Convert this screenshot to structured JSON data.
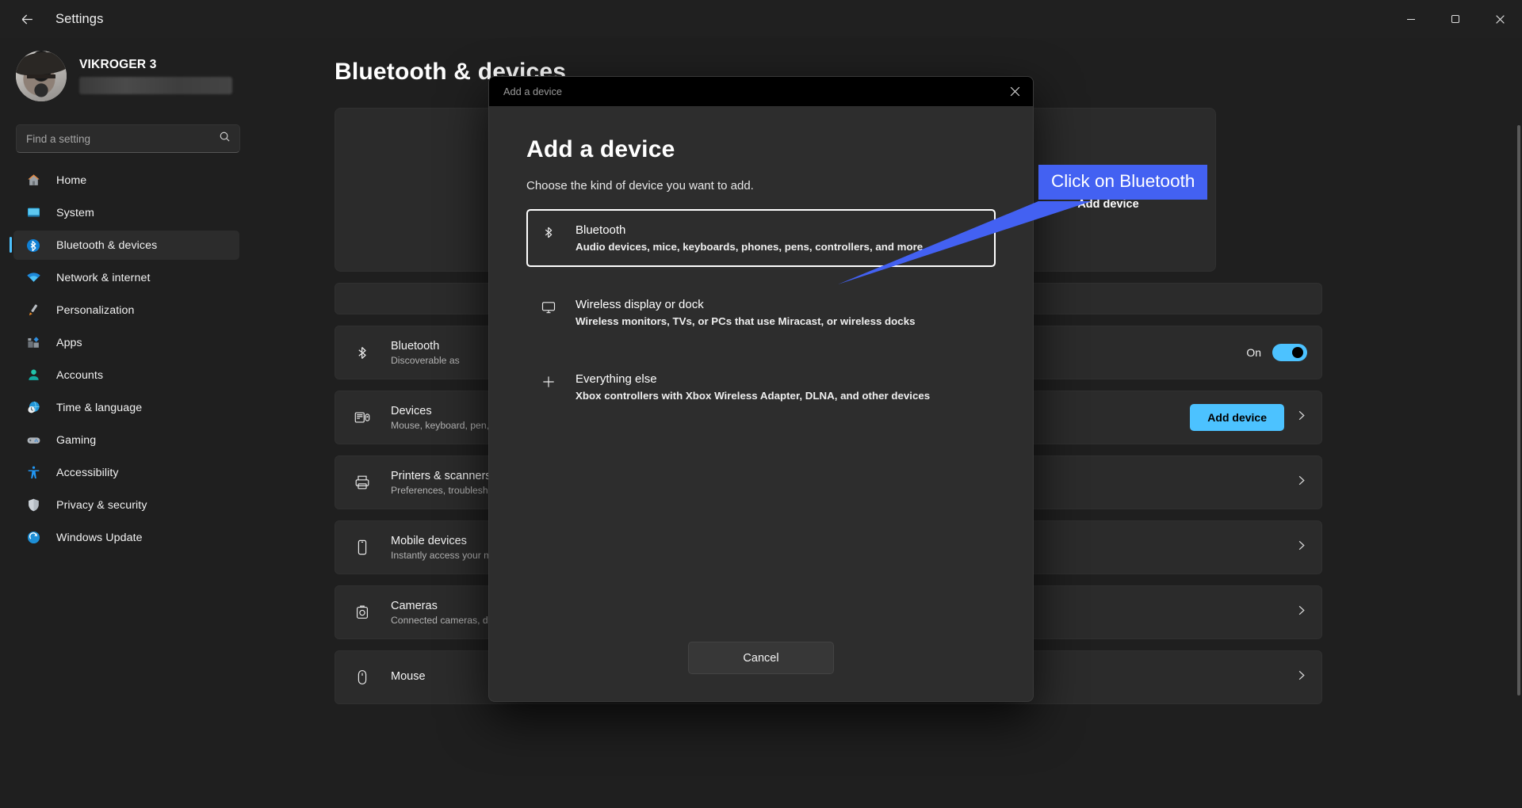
{
  "window": {
    "title": "Settings",
    "back_icon": "back-arrow-icon",
    "controls": {
      "minimize": "minimize-icon",
      "maximize": "maximize-icon",
      "close": "close-icon"
    }
  },
  "account": {
    "name": "VIKROGER 3",
    "email_redacted": true,
    "avatar": "user-avatar"
  },
  "search": {
    "placeholder": "Find a setting",
    "value": "",
    "icon": "search-icon"
  },
  "sidebar": {
    "items": [
      {
        "label": "Home",
        "icon": "home-icon",
        "active": false
      },
      {
        "label": "System",
        "icon": "system-icon",
        "active": false
      },
      {
        "label": "Bluetooth & devices",
        "icon": "bluetooth-icon",
        "active": true
      },
      {
        "label": "Network & internet",
        "icon": "wifi-icon",
        "active": false
      },
      {
        "label": "Personalization",
        "icon": "paintbrush-icon",
        "active": false
      },
      {
        "label": "Apps",
        "icon": "apps-icon",
        "active": false
      },
      {
        "label": "Accounts",
        "icon": "accounts-icon",
        "active": false
      },
      {
        "label": "Time & language",
        "icon": "clock-globe-icon",
        "active": false
      },
      {
        "label": "Gaming",
        "icon": "gamepad-icon",
        "active": false
      },
      {
        "label": "Accessibility",
        "icon": "accessibility-icon",
        "active": false
      },
      {
        "label": "Privacy & security",
        "icon": "shield-icon",
        "active": false
      },
      {
        "label": "Windows Update",
        "icon": "update-icon",
        "active": false
      }
    ]
  },
  "main": {
    "page_title": "Bluetooth & devices",
    "device_card": {
      "more_icon": "more-dots-icon"
    },
    "add_device_card": {
      "label": "Add device",
      "plus_icon": "plus-icon"
    },
    "rows": [
      {
        "title": "Bluetooth",
        "subtitle": "Discoverable as",
        "icon": "bluetooth-icon",
        "control": "toggle",
        "toggle_label": "On",
        "toggle_on": true
      },
      {
        "title": "Devices",
        "subtitle": "Mouse, keyboard, pen, audio, displays and docks, other devices",
        "icon": "devices-icon",
        "control": "button",
        "button_label": "Add device",
        "chevron": "chevron-right-icon"
      },
      {
        "title": "Printers & scanners",
        "subtitle": "Preferences, troubleshoot",
        "icon": "printer-icon",
        "control": "chevron",
        "chevron": "chevron-right-icon"
      },
      {
        "title": "Mobile devices",
        "subtitle": "Instantly access your mobile devices from your PC",
        "icon": "phone-icon",
        "control": "chevron",
        "chevron": "chevron-right-icon"
      },
      {
        "title": "Cameras",
        "subtitle": "Connected cameras, default image settings",
        "icon": "camera-icon",
        "control": "chevron",
        "chevron": "chevron-right-icon"
      },
      {
        "title": "Mouse",
        "subtitle": "",
        "icon": "mouse-icon",
        "control": "chevron",
        "chevron": "chevron-right-icon"
      }
    ]
  },
  "modal": {
    "titlebar_text": "Add a device",
    "close_icon": "close-icon",
    "heading": "Add a device",
    "subtitle": "Choose the kind of device you want to add.",
    "options": [
      {
        "title": "Bluetooth",
        "description": "Audio devices, mice, keyboards, phones, pens, controllers, and more",
        "icon": "bluetooth-icon",
        "focused": true
      },
      {
        "title": "Wireless display or dock",
        "description": "Wireless monitors, TVs, or PCs that use Miracast, or wireless docks",
        "icon": "monitor-icon",
        "focused": false
      },
      {
        "title": "Everything else",
        "description": "Xbox controllers with Xbox Wireless Adapter, DLNA, and other devices",
        "icon": "plus-icon",
        "focused": false
      }
    ],
    "cancel_label": "Cancel"
  },
  "callout": {
    "text": "Click on Bluetooth",
    "color": "#4361f2",
    "text_color": "#ffffff"
  },
  "colors": {
    "accent": "#4cc2ff",
    "window_bg": "#202020",
    "card_bg": "#2b2b2b",
    "modal_bg": "#2d2d2d",
    "callout_blue": "#4361f2"
  }
}
